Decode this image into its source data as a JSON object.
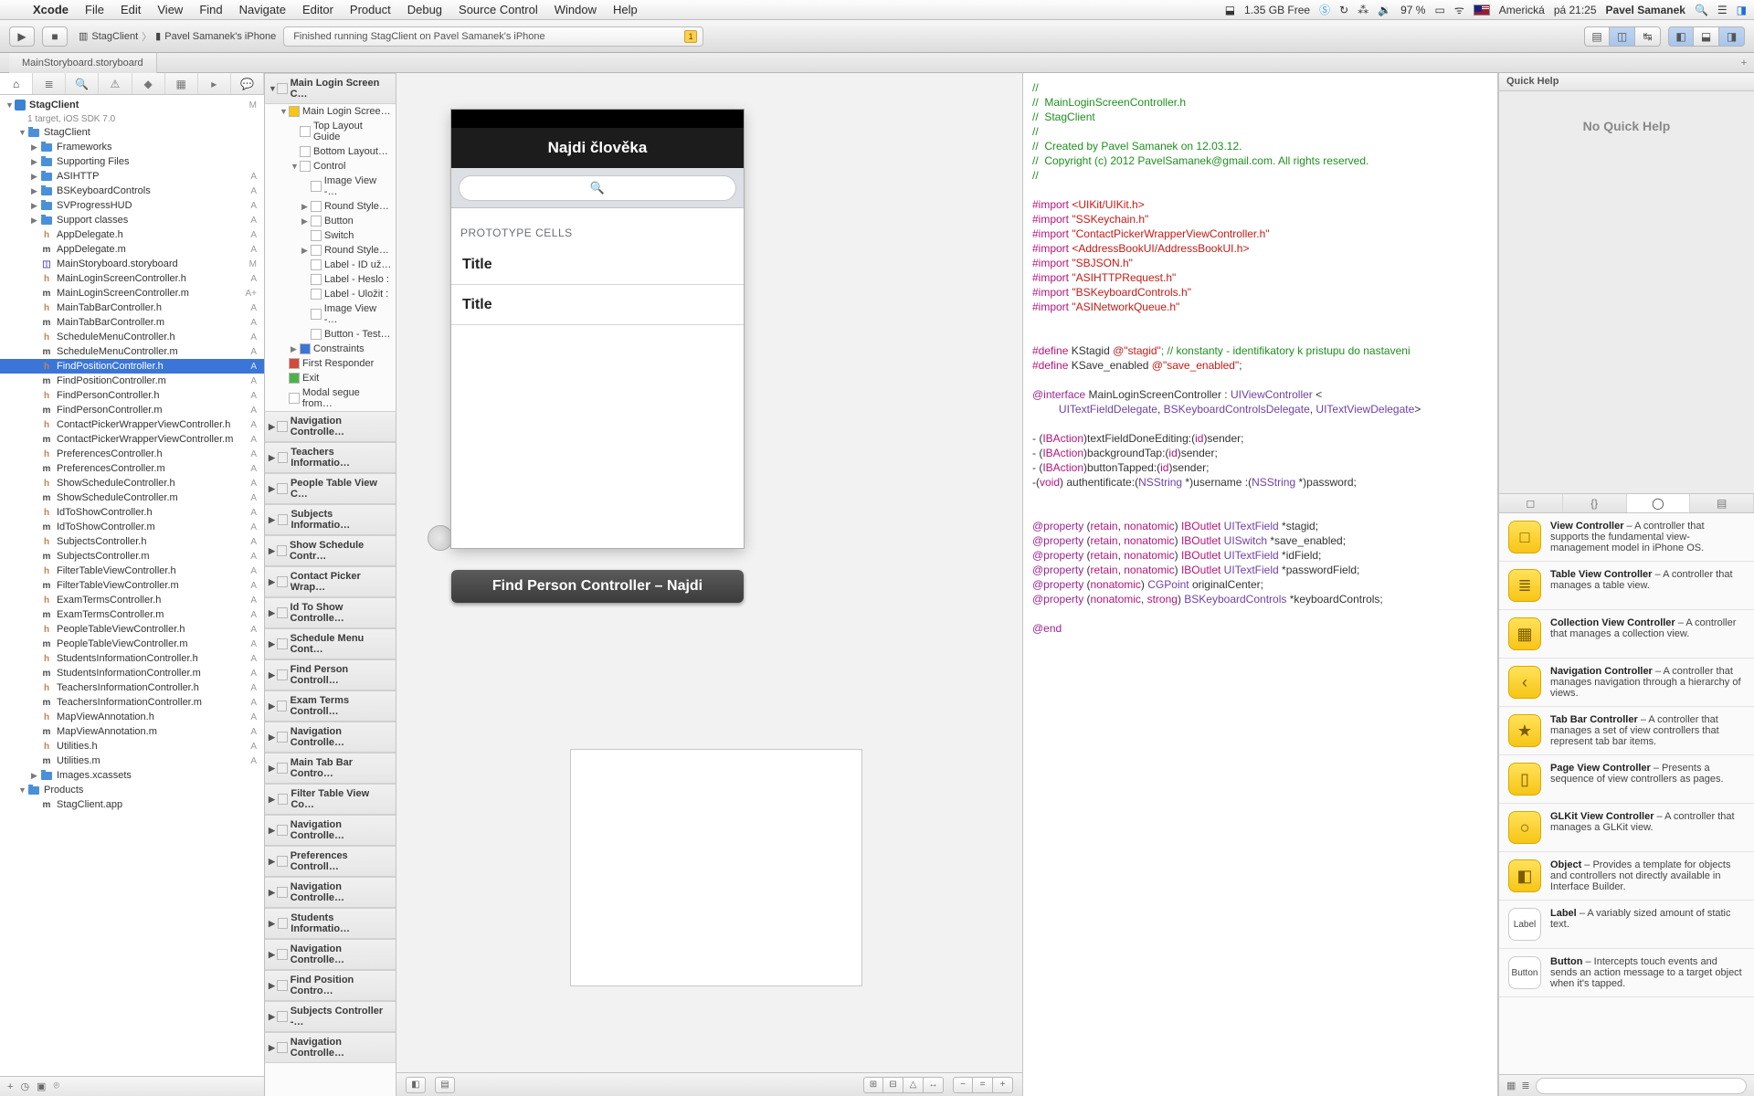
{
  "menubar": {
    "app": "Xcode",
    "items": [
      "File",
      "Edit",
      "View",
      "Find",
      "Navigate",
      "Editor",
      "Product",
      "Debug",
      "Source Control",
      "Window",
      "Help"
    ],
    "status_free": "1.35 GB Free",
    "battery": "97 %",
    "input": "Americká",
    "day_time": "pá 21:25",
    "user": "Pavel Samanek"
  },
  "toolbar": {
    "scheme": "StagClient",
    "destination": "Pavel Samanek's iPhone",
    "activity": "Finished running StagClient on Pavel Samanek's iPhone",
    "warning_count": "1"
  },
  "tab": "MainStoryboard.storyboard",
  "project": {
    "name": "StagClient",
    "subtitle": "1 target, iOS SDK 7.0",
    "tree": [
      {
        "n": "StagClient",
        "i": "folder",
        "d": 1,
        "o": 1
      },
      {
        "n": "Frameworks",
        "i": "folder",
        "d": 2
      },
      {
        "n": "Supporting Files",
        "i": "folder",
        "d": 2
      },
      {
        "n": "ASIHTTP",
        "i": "folder",
        "d": 2,
        "t": "A"
      },
      {
        "n": "BSKeyboardControls",
        "i": "folder",
        "d": 2,
        "t": "A"
      },
      {
        "n": "SVProgressHUD",
        "i": "folder",
        "d": 2,
        "t": "A"
      },
      {
        "n": "Support classes",
        "i": "folder",
        "d": 2,
        "t": "A"
      },
      {
        "n": "AppDelegate.h",
        "i": "h",
        "d": 2,
        "t": "A"
      },
      {
        "n": "AppDelegate.m",
        "i": "m",
        "d": 2,
        "t": "A"
      },
      {
        "n": "MainStoryboard.storyboard",
        "i": "sb",
        "d": 2,
        "t": "M"
      },
      {
        "n": "MainLoginScreenController.h",
        "i": "h",
        "d": 2,
        "t": "A"
      },
      {
        "n": "MainLoginScreenController.m",
        "i": "m",
        "d": 2,
        "t": "A+"
      },
      {
        "n": "MainTabBarController.h",
        "i": "h",
        "d": 2,
        "t": "A"
      },
      {
        "n": "MainTabBarController.m",
        "i": "m",
        "d": 2,
        "t": "A"
      },
      {
        "n": "ScheduleMenuController.h",
        "i": "h",
        "d": 2,
        "t": "A"
      },
      {
        "n": "ScheduleMenuController.m",
        "i": "m",
        "d": 2,
        "t": "A"
      },
      {
        "n": "FindPositionController.h",
        "i": "h",
        "d": 2,
        "t": "A",
        "sel": 1
      },
      {
        "n": "FindPositionController.m",
        "i": "m",
        "d": 2,
        "t": "A"
      },
      {
        "n": "FindPersonController.h",
        "i": "h",
        "d": 2,
        "t": "A"
      },
      {
        "n": "FindPersonController.m",
        "i": "m",
        "d": 2,
        "t": "A"
      },
      {
        "n": "ContactPickerWrapperViewController.h",
        "i": "h",
        "d": 2,
        "t": "A"
      },
      {
        "n": "ContactPickerWrapperViewController.m",
        "i": "m",
        "d": 2,
        "t": "A"
      },
      {
        "n": "PreferencesController.h",
        "i": "h",
        "d": 2,
        "t": "A"
      },
      {
        "n": "PreferencesController.m",
        "i": "m",
        "d": 2,
        "t": "A"
      },
      {
        "n": "ShowScheduleController.h",
        "i": "h",
        "d": 2,
        "t": "A"
      },
      {
        "n": "ShowScheduleController.m",
        "i": "m",
        "d": 2,
        "t": "A"
      },
      {
        "n": "IdToShowController.h",
        "i": "h",
        "d": 2,
        "t": "A"
      },
      {
        "n": "IdToShowController.m",
        "i": "m",
        "d": 2,
        "t": "A"
      },
      {
        "n": "SubjectsController.h",
        "i": "h",
        "d": 2,
        "t": "A"
      },
      {
        "n": "SubjectsController.m",
        "i": "m",
        "d": 2,
        "t": "A"
      },
      {
        "n": "FilterTableViewController.h",
        "i": "h",
        "d": 2,
        "t": "A"
      },
      {
        "n": "FilterTableViewController.m",
        "i": "m",
        "d": 2,
        "t": "A"
      },
      {
        "n": "ExamTermsController.h",
        "i": "h",
        "d": 2,
        "t": "A"
      },
      {
        "n": "ExamTermsController.m",
        "i": "m",
        "d": 2,
        "t": "A"
      },
      {
        "n": "PeopleTableViewController.h",
        "i": "h",
        "d": 2,
        "t": "A"
      },
      {
        "n": "PeopleTableViewController.m",
        "i": "m",
        "d": 2,
        "t": "A"
      },
      {
        "n": "StudentsInformationController.h",
        "i": "h",
        "d": 2,
        "t": "A"
      },
      {
        "n": "StudentsInformationController.m",
        "i": "m",
        "d": 2,
        "t": "A"
      },
      {
        "n": "TeachersInformationController.h",
        "i": "h",
        "d": 2,
        "t": "A"
      },
      {
        "n": "TeachersInformationController.m",
        "i": "m",
        "d": 2,
        "t": "A"
      },
      {
        "n": "MapViewAnnotation.h",
        "i": "h",
        "d": 2,
        "t": "A"
      },
      {
        "n": "MapViewAnnotation.m",
        "i": "m",
        "d": 2,
        "t": "A"
      },
      {
        "n": "Utilities.h",
        "i": "h",
        "d": 2,
        "t": "A"
      },
      {
        "n": "Utilities.m",
        "i": "m",
        "d": 2,
        "t": "A"
      },
      {
        "n": "Images.xcassets",
        "i": "folder",
        "d": 2
      },
      {
        "n": "Products",
        "i": "folder",
        "d": 1,
        "o": 1
      },
      {
        "n": "StagClient.app",
        "i": "m",
        "d": 2
      }
    ]
  },
  "outline": {
    "top": {
      "scene": "Main Login Screen C…",
      "items": [
        {
          "n": "Main Login Scree…",
          "d": 1,
          "o": 1,
          "yellow": 1
        },
        {
          "n": "Top Layout Guide",
          "d": 2
        },
        {
          "n": "Bottom Layout…",
          "d": 2
        },
        {
          "n": "Control",
          "d": 2,
          "o": 1
        },
        {
          "n": "Image View -…",
          "d": 3
        },
        {
          "n": "Round Style…",
          "d": 3,
          "tri": 1
        },
        {
          "n": "Button",
          "d": 3,
          "tri": 1
        },
        {
          "n": "Switch",
          "d": 3
        },
        {
          "n": "Round Style…",
          "d": 3,
          "tri": 1
        },
        {
          "n": "Label - ID už…",
          "d": 3
        },
        {
          "n": "Label - Heslo :",
          "d": 3
        },
        {
          "n": "Label - Uložit :",
          "d": 3
        },
        {
          "n": "Image View -…",
          "d": 3
        },
        {
          "n": "Button - Test…",
          "d": 3
        },
        {
          "n": "Constraints",
          "d": 2,
          "blue": 1,
          "tri": 1
        },
        {
          "n": "First Responder",
          "d": 1,
          "red": 1
        },
        {
          "n": "Exit",
          "d": 1,
          "green": 1
        },
        {
          "n": "Modal segue from…",
          "d": 1
        }
      ]
    },
    "scenes": [
      "Navigation Controlle…",
      "Teachers Informatio…",
      "People Table View C…",
      "Subjects Informatio…",
      "Show Schedule Contr…",
      "Contact Picker Wrap…",
      "Id To Show Controlle…",
      "Schedule Menu Cont…",
      "Find Person Controll…",
      "Exam Terms Controll…",
      "Navigation Controlle…",
      "Main Tab Bar Contro…",
      "Filter Table View Co…",
      "Navigation Controlle…",
      "Preferences Controll…",
      "Navigation Controlle…",
      "Students Informatio…",
      "Navigation Controlle…",
      "Find Position Contro…",
      "Subjects Controller -…",
      "Navigation Controlle…"
    ]
  },
  "canvas": {
    "navbar_title": "Najdi člověka",
    "search_icon": "🔍",
    "proto_label": "PROTOTYPE CELLS",
    "cell_title": "Title",
    "fp_title": "Find Person Controller – Najdi"
  },
  "code": {
    "c1": "//",
    "c2": "//  MainLoginScreenController.h",
    "c3": "//  StagClient",
    "c4": "//",
    "c5": "//  Created by Pavel Samanek on 12.03.12.",
    "c6": "//  Copyright (c) 2012 PavelSamanek@gmail.com. All rights reserved.",
    "c7": "//",
    "imp1a": "#import ",
    "imp1b": "<UIKit/UIKit.h>",
    "imp2a": "#import ",
    "imp2b": "\"SSKeychain.h\"",
    "imp3a": "#import ",
    "imp3b": "\"ContactPickerWrapperViewController.h\"",
    "imp4a": "#import ",
    "imp4b": "<AddressBookUI/AddressBookUI.h>",
    "imp5a": "#import ",
    "imp5b": "\"SBJSON.h\"",
    "imp6a": "#import ",
    "imp6b": "\"ASIHTTPRequest.h\"",
    "imp7a": "#import ",
    "imp7b": "\"BSKeyboardControls.h\"",
    "imp8a": "#import ",
    "imp8b": "\"ASINetworkQueue.h\"",
    "d1a": "#define",
    " d1b": " KStagid ",
    "d1c": "@\"stagid\"",
    "d1d": "; // konstanty - identifikatory k pristupu do nastaveni",
    "d2a": "#define",
    "d2b": " KSave_enabled ",
    "d2c": "@\"save_enabled\"",
    "d2d": ";",
    "if_kw": "@interface ",
    "if_name": "MainLoginScreenController : ",
    "if_sup": "UIViewController",
    "if_open": " <",
    "if_p1": "UITextFieldDelegate",
    "if_c1": ", ",
    "if_p2": "BSKeyboardControlsDelegate",
    "if_c2": ", ",
    "if_p3": "UITextViewDelegate",
    "if_close": ">",
    "m1": "- (",
    "m1t": "IBAction",
    "m1r": ")textFieldDoneEditing:(",
    "m1i": "id",
    "m1e": ")sender;",
    "m2": "- (",
    "m2t": "IBAction",
    "m2r": ")backgroundTap:(",
    "m2i": "id",
    "m2e": ")sender;",
    "m3": "- (",
    "m3t": "IBAction",
    "m3r": ")buttonTapped:(",
    "m3i": "id",
    "m3e": ")sender;",
    "m4": "-(",
    "m4t": "void",
    "m4r": ") authentificate:(",
    "m4s": "NSString",
    "m4m": " *)username :(",
    "m4s2": "NSString",
    "m4e": " *)password;",
    "p_kw": "@property ",
    "p_attr": "(",
    "p_r": "retain",
    "p_comma": ", ",
    "p_n": "nonatomic",
    "p_close": ") ",
    "p_ib": "IBOutlet ",
    "p1t": "UITextField",
    "p1n": " *stagid;",
    "p2t": "UISwitch",
    "p2n": " *save_enabled;",
    "p3t": "UITextField",
    "p3n": " *idField;",
    "p4t": "UITextField",
    "p4n": " *passwordField;",
    "p5a": "(",
    "p5n": "nonatomic",
    "p5c": ") ",
    "p5t": "CGPoint",
    "p5name": " originalCenter;",
    "p6a": "(",
    "p6n": "nonatomic",
    "p6c": ", ",
    "p6s": "strong",
    "p6e": ") ",
    "p6t": "BSKeyboardControls",
    "p6name": " *keyboardControls;",
    "end": "@end"
  },
  "inspector": {
    "quick_help_title": "Quick Help",
    "no_help": "No Quick Help",
    "library": [
      {
        "t": "View Controller",
        "d": " – A controller that supports the fundamental view-management model in iPhone OS.",
        "g": "□"
      },
      {
        "t": "Table View Controller",
        "d": " – A controller that manages a table view.",
        "g": "≣"
      },
      {
        "t": "Collection View Controller",
        "d": " – A controller that manages a collection view.",
        "g": "▦"
      },
      {
        "t": "Navigation Controller",
        "d": " – A controller that manages navigation through a hierarchy of views.",
        "g": "‹"
      },
      {
        "t": "Tab Bar Controller",
        "d": " – A controller that manages a set of view controllers that represent tab bar items.",
        "g": "★"
      },
      {
        "t": "Page View Controller",
        "d": " – Presents a sequence of view controllers as pages.",
        "g": "▯"
      },
      {
        "t": "GLKit View Controller",
        "d": " – A controller that manages a GLKit view.",
        "g": "○"
      },
      {
        "t": "Object",
        "d": " – Provides a template for objects and controllers not directly available in Interface Builder.",
        "g": "◧"
      },
      {
        "t": "Label",
        "d": " – A variably sized amount of static text.",
        "g": "Label",
        "plain": 1
      },
      {
        "t": "Button",
        "d": " – Intercepts touch events and sends an action message to a target object when it's tapped.",
        "g": "Button",
        "plain": 1
      }
    ]
  }
}
